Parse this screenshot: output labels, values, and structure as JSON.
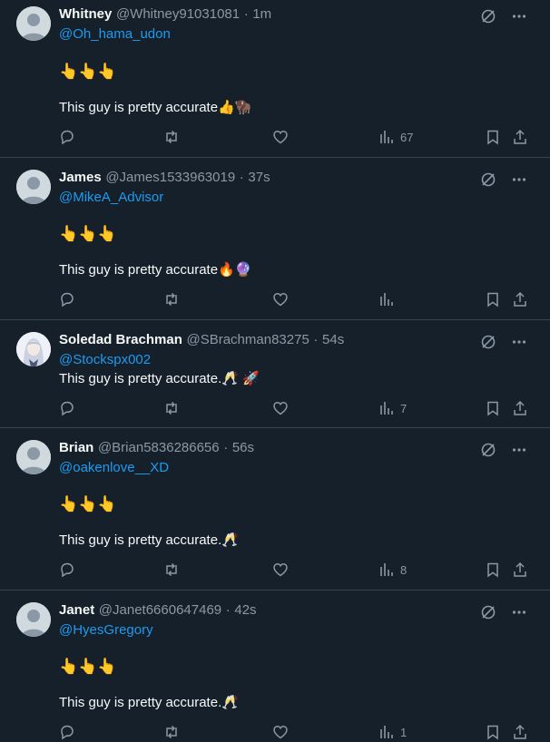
{
  "tweets": [
    {
      "name": "Whitney",
      "handle": "@Whitney91031081",
      "sep": "·",
      "time": "1m",
      "mention": "@Oh_hama_udon",
      "emoji_line": "👆👆👆",
      "text": "This guy is pretty accurate👍🦬",
      "views": "67"
    },
    {
      "name": "James",
      "handle": "@James1533963019",
      "sep": "·",
      "time": "37s",
      "mention": "@MikeA_Advisor",
      "emoji_line": "👆👆👆",
      "text": "This guy is pretty accurate🔥🔮",
      "views": ""
    },
    {
      "name": "Soledad Brachman",
      "handle": "@SBrachman83275",
      "sep": "·",
      "time": "54s",
      "mention": "@Stockspx002",
      "emoji_line": "",
      "text": "This guy is pretty accurate.🥂 🚀",
      "views": "7"
    },
    {
      "name": "Brian",
      "handle": "@Brian5836286656",
      "sep": "·",
      "time": "56s",
      "mention": "@oakenlove__XD",
      "emoji_line": "👆👆👆",
      "text": "This guy is pretty accurate.🥂",
      "views": "8"
    },
    {
      "name": "Janet",
      "handle": "@Janet6660647469",
      "sep": "·",
      "time": "42s",
      "mention": "@HyesGregory",
      "emoji_line": "👆👆👆",
      "text": "This guy is pretty accurate.🥂",
      "views": "1"
    }
  ],
  "icons": {
    "top": [
      "grok-icon",
      "more-icon"
    ],
    "actions": [
      "reply-icon",
      "retweet-icon",
      "like-icon",
      "views-icon",
      "bookmark-icon",
      "share-icon"
    ]
  },
  "colors": {
    "background": "#15202b",
    "divider": "#38444d",
    "muted": "#8b98a5",
    "link": "#1d9bf0",
    "text": "#f7f9f9"
  }
}
